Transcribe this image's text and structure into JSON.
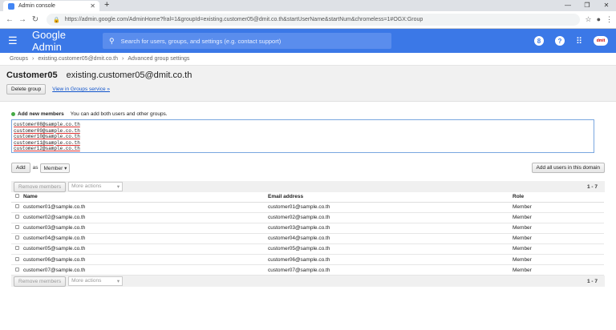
{
  "browser": {
    "tab_title": "Admin console",
    "url": "https://admin.google.com/AdminHome?fral=1&groupId=existing.customer05@dmit.co.th&startUserName&startNum&chromeless=1#OGX:Group"
  },
  "appbar": {
    "brand": "Google Admin",
    "search_placeholder": "Search for users, groups, and settings (e.g. contact support)",
    "cloud_label": "dmit"
  },
  "breadcrumb": [
    "Groups",
    "existing.customer05@dmit.co.th",
    "Advanced group settings"
  ],
  "group": {
    "name": "Customer05",
    "email": "existing.customer05@dmit.co.th",
    "delete_label": "Delete group",
    "view_link": "View in Groups service »"
  },
  "add_members": {
    "title": "Add new members",
    "hint": "You can add both users and other groups.",
    "entries": [
      "customer08@sample.co.th",
      "customer09@sample.co.th",
      "customer10@sample.co.th",
      "customer11@sample.co.th",
      "customer12@sample.co.th"
    ],
    "add_label": "Add",
    "as_label": "as",
    "role_select": "Member",
    "add_all_label": "Add all users in this domain"
  },
  "toolbar": {
    "remove_label": "Remove members",
    "more_actions": "More actions",
    "range": "1 - 7"
  },
  "table": {
    "headers": {
      "name": "Name",
      "email": "Email address",
      "role": "Role"
    },
    "rows": [
      {
        "name": "customer01@sample.co.th",
        "email": "customer01@sample.co.th",
        "role": "Member"
      },
      {
        "name": "customer02@sample.co.th",
        "email": "customer02@sample.co.th",
        "role": "Member"
      },
      {
        "name": "customer03@sample.co.th",
        "email": "customer03@sample.co.th",
        "role": "Member"
      },
      {
        "name": "customer04@sample.co.th",
        "email": "customer04@sample.co.th",
        "role": "Member"
      },
      {
        "name": "customer05@sample.co.th",
        "email": "customer05@sample.co.th",
        "role": "Member"
      },
      {
        "name": "customer06@sample.co.th",
        "email": "customer06@sample.co.th",
        "role": "Member"
      },
      {
        "name": "customer07@sample.co.th",
        "email": "customer07@sample.co.th",
        "role": "Member"
      }
    ]
  }
}
